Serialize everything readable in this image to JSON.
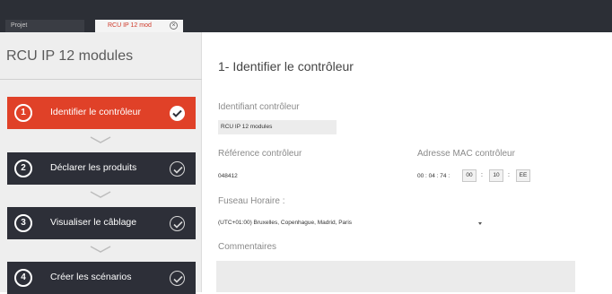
{
  "tabs": [
    {
      "label": "Projet"
    },
    {
      "label": "RCU IP 12 mod"
    }
  ],
  "sidebar": {
    "title": "RCU IP 12 modules",
    "steps": [
      {
        "number": "1",
        "label": "Identifier le contrôleur",
        "active": true
      },
      {
        "number": "2",
        "label": "Déclarer les produits",
        "active": false
      },
      {
        "number": "3",
        "label": "Visualiser le câblage",
        "active": false
      },
      {
        "number": "4",
        "label": "Créer les scénarios",
        "active": false
      }
    ]
  },
  "main": {
    "title": "1- Identifier le contrôleur",
    "controller_id": {
      "label": "Identifiant contrôleur",
      "value": "RCU IP 12 modules"
    },
    "controller_ref": {
      "label": "Référence contrôleur",
      "value": "048412"
    },
    "mac": {
      "label": "Adresse MAC contrôleur",
      "fixed": "00 : 04 : 74 :",
      "parts": [
        "00",
        "10",
        "EE"
      ]
    },
    "timezone": {
      "label": "Fuseau Horaire :",
      "value": "(UTC+01:00) Bruxelles, Copenhague, Madrid, Paris"
    },
    "comments": {
      "label": "Commentaires",
      "value": ""
    }
  },
  "colors": {
    "accent": "#e04128",
    "step_bg": "#2d2f38",
    "topbar": "#2c2f36",
    "sidebar_bg": "#eeeeee"
  },
  "icons": [
    "close-icon",
    "check-icon",
    "chevron-down-icon",
    "dropdown-arrow-icon"
  ]
}
